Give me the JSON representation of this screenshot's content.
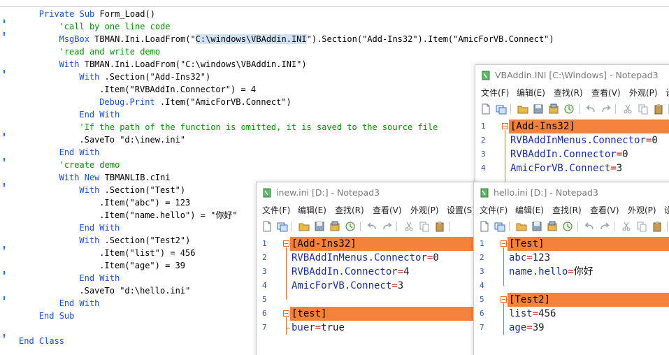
{
  "code_editor": {
    "lines": [
      {
        "indent": 1,
        "parts": [
          {
            "t": "Private Sub ",
            "c": "kw"
          },
          {
            "t": "Form_Load()",
            "c": ""
          }
        ]
      },
      {
        "indent": 2,
        "parts": [
          {
            "t": "'call by one line code",
            "c": "cm"
          }
        ]
      },
      {
        "indent": 2,
        "parts": [
          {
            "t": "MsgBox",
            "c": "kw"
          },
          {
            "t": " TBMAN.Ini.LoadFrom(\"",
            "c": ""
          },
          {
            "t": "C:\\windows\\VBAddin.INI",
            "c": "hl"
          },
          {
            "t": "\").Section(\"Add-Ins32\").Item(\"AmicForVB.Connect\")",
            "c": ""
          }
        ]
      },
      {
        "indent": 2,
        "parts": [
          {
            "t": "'read and write demo",
            "c": "cm"
          }
        ]
      },
      {
        "indent": 2,
        "parts": [
          {
            "t": "With",
            "c": "kw"
          },
          {
            "t": " TBMAN.Ini.LoadFrom(\"C:\\windows\\VBAddin.INI\")",
            "c": ""
          }
        ]
      },
      {
        "indent": 3,
        "parts": [
          {
            "t": "With",
            "c": "kw"
          },
          {
            "t": " .Section(\"Add-Ins32\")",
            "c": ""
          }
        ]
      },
      {
        "indent": 4,
        "parts": [
          {
            "t": ".Item(\"RVBAddIn.Connector\") = 4",
            "c": ""
          }
        ]
      },
      {
        "indent": 4,
        "parts": [
          {
            "t": "Debug.Print",
            "c": "kw"
          },
          {
            "t": " .Item(\"AmicForVB.Connect\")",
            "c": ""
          }
        ]
      },
      {
        "indent": 3,
        "parts": [
          {
            "t": "End With",
            "c": "kw"
          }
        ]
      },
      {
        "indent": 3,
        "parts": [
          {
            "t": "'If the path of the function is omitted, it is saved to the source file",
            "c": "cm"
          }
        ]
      },
      {
        "indent": 3,
        "parts": [
          {
            "t": ".SaveTo \"d:\\inew.ini\"",
            "c": ""
          }
        ]
      },
      {
        "indent": 2,
        "parts": [
          {
            "t": "End With",
            "c": "kw"
          }
        ]
      },
      {
        "indent": 2,
        "parts": [
          {
            "t": "'create demo",
            "c": "cm"
          }
        ]
      },
      {
        "indent": 2,
        "parts": [
          {
            "t": "With New",
            "c": "kw"
          },
          {
            "t": " TBMANLIB.cIni",
            "c": ""
          }
        ]
      },
      {
        "indent": 3,
        "parts": [
          {
            "t": "With",
            "c": "kw"
          },
          {
            "t": " .Section(\"Test\")",
            "c": ""
          }
        ]
      },
      {
        "indent": 4,
        "parts": [
          {
            "t": ".Item(\"abc\") = 123",
            "c": ""
          }
        ]
      },
      {
        "indent": 4,
        "parts": [
          {
            "t": ".Item(\"name.hello\") = \"你好\"",
            "c": ""
          }
        ]
      },
      {
        "indent": 3,
        "parts": [
          {
            "t": "End With",
            "c": "kw"
          }
        ]
      },
      {
        "indent": 3,
        "parts": [
          {
            "t": "With",
            "c": "kw"
          },
          {
            "t": " .Section(\"Test2\")",
            "c": ""
          }
        ]
      },
      {
        "indent": 4,
        "parts": [
          {
            "t": ".Item(\"list\") = 456",
            "c": ""
          }
        ]
      },
      {
        "indent": 4,
        "parts": [
          {
            "t": ".Item(\"age\") = 39",
            "c": ""
          }
        ]
      },
      {
        "indent": 3,
        "parts": [
          {
            "t": "End With",
            "c": "kw"
          }
        ]
      },
      {
        "indent": 3,
        "parts": [
          {
            "t": ".SaveTo \"d:\\hello.ini\"",
            "c": ""
          }
        ]
      },
      {
        "indent": 2,
        "parts": [
          {
            "t": "End With",
            "c": "kw"
          }
        ]
      },
      {
        "indent": 1,
        "parts": [
          {
            "t": "End Sub",
            "c": "kw"
          }
        ]
      },
      {
        "indent": 0,
        "parts": [
          {
            "t": "",
            "c": ""
          }
        ]
      },
      {
        "indent": 0,
        "parts": [
          {
            "t": "End Class",
            "c": "kw"
          }
        ]
      }
    ]
  },
  "notepads": [
    {
      "id": "vbaddin",
      "title": "VBAddin.INI [C:\\Windows] - Notepad3",
      "menu": [
        "文件(F)",
        "编辑(E)",
        "查找(R)",
        "查看(V)",
        "外观(P)",
        "设"
      ],
      "lines": [
        {
          "n": "1",
          "type": "section",
          "text": "[Add-Ins32]"
        },
        {
          "n": "2",
          "type": "kv",
          "key": "RVBAddInMenus.Connector",
          "value": "0"
        },
        {
          "n": "3",
          "type": "kv",
          "key": "RVBAddIn.Connector",
          "value": "0"
        },
        {
          "n": "4",
          "type": "kv",
          "key": "AmicForVB.Connect",
          "value": "3"
        }
      ]
    },
    {
      "id": "inew",
      "title": "inew.ini [D:] - Notepad3",
      "menu": [
        "文件(F)",
        "编辑(E)",
        "查找(R)",
        "查看(V)",
        "外观(P)",
        "设置(S)"
      ],
      "lines": [
        {
          "n": "1",
          "type": "section",
          "text": "[Add-Ins32]"
        },
        {
          "n": "2",
          "type": "kv",
          "key": "RVBAddInMenus.Connector",
          "value": "0"
        },
        {
          "n": "3",
          "type": "kv",
          "key": "RVBAddIn.Connector",
          "value": "4"
        },
        {
          "n": "4",
          "type": "kv",
          "key": "AmicForVB.Connect",
          "value": "3"
        },
        {
          "n": "5",
          "type": "blank"
        },
        {
          "n": "6",
          "type": "section",
          "text": "[test]"
        },
        {
          "n": "7",
          "type": "kv",
          "key": "buer",
          "value": "true"
        }
      ]
    },
    {
      "id": "hello",
      "title": "hello.ini [D:] - Notepad3",
      "menu": [
        "文件(F)",
        "编辑(E)",
        "查找(R)",
        "查看(V)",
        "外观(P)",
        "设"
      ],
      "lines": [
        {
          "n": "1",
          "type": "section",
          "text": "[Test]"
        },
        {
          "n": "2",
          "type": "kv",
          "key": "abc",
          "value": "123"
        },
        {
          "n": "3",
          "type": "kv",
          "key": "name.hello",
          "value": "你好"
        },
        {
          "n": "4",
          "type": "blank"
        },
        {
          "n": "5",
          "type": "section",
          "text": "[Test2]"
        },
        {
          "n": "6",
          "type": "kv",
          "key": "list",
          "value": "456"
        },
        {
          "n": "7",
          "type": "kv",
          "key": "age",
          "value": "39"
        }
      ]
    }
  ],
  "toolbar_icons": [
    "new-file-icon",
    "new-window-icon",
    "open-folder-icon",
    "save-icon",
    "save-as-icon",
    "refresh-icon",
    "undo-icon",
    "redo-icon",
    "cut-icon",
    "copy-icon",
    "paste-icon"
  ],
  "colors": {
    "section_highlight": "#f4823c",
    "keyword": "#1a50c8",
    "comment": "#0a8a0a",
    "ini_key": "#1a2f95",
    "ini_equals": "#d1201c",
    "selection": "#cfe2f7"
  }
}
